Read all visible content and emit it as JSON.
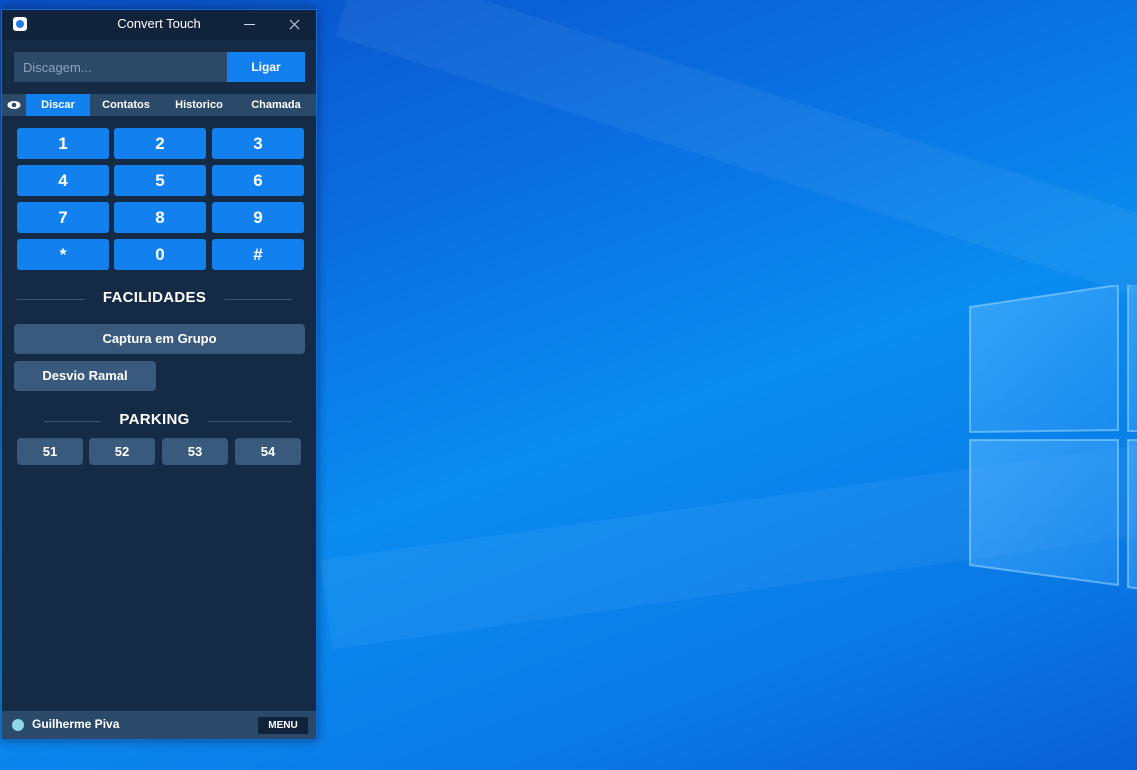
{
  "window": {
    "title": "Convert Touch"
  },
  "dial": {
    "placeholder": "Discagem...",
    "value": "",
    "call_label": "Ligar"
  },
  "tabs": [
    {
      "label": "Discar",
      "active": true
    },
    {
      "label": "Contatos",
      "active": false
    },
    {
      "label": "Historico",
      "active": false
    },
    {
      "label": "Chamada",
      "active": false
    }
  ],
  "keypad": {
    "keys": [
      "1",
      "2",
      "3",
      "4",
      "5",
      "6",
      "7",
      "8",
      "9",
      "*",
      "0",
      "#"
    ]
  },
  "facilidades": {
    "heading": "FACILIDADES",
    "buttons": [
      "Captura em Grupo",
      "Desvio Ramal"
    ]
  },
  "parking": {
    "heading": "PARKING",
    "slots": [
      "51",
      "52",
      "53",
      "54"
    ]
  },
  "status": {
    "user": "Guilherme Piva",
    "menu_label": "MENU",
    "presence_color": "#8fd8e8"
  },
  "colors": {
    "accent": "#1380f0",
    "panel_bg": "#142a45",
    "secondary_button": "#3a5a7d"
  }
}
